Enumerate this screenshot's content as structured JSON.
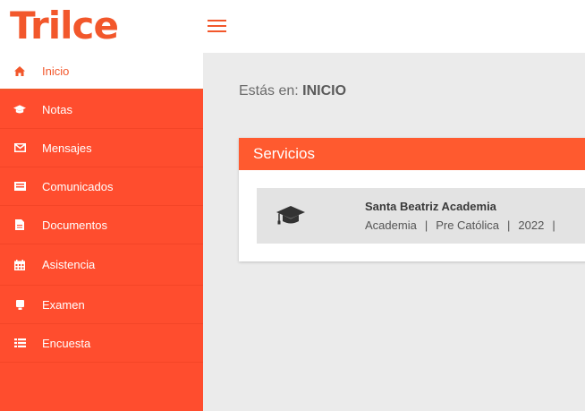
{
  "header": {
    "logo_text": "Trilce",
    "brand_color": "#f2572b"
  },
  "sidebar": {
    "items": [
      {
        "label": "Inicio",
        "icon": "home-icon",
        "active": true
      },
      {
        "label": "Notas",
        "icon": "graduation-cap-icon"
      },
      {
        "label": "Mensajes",
        "icon": "envelope-icon"
      },
      {
        "label": "Comunicados",
        "icon": "newspaper-icon"
      },
      {
        "label": "Documentos",
        "icon": "document-icon"
      },
      {
        "label": "Asistencia",
        "icon": "calendar-icon"
      },
      {
        "label": "Examen",
        "icon": "exam-icon"
      },
      {
        "label": "Encuesta",
        "icon": "list-icon"
      }
    ],
    "bg_color": "#ff4d2e"
  },
  "main": {
    "breadcrumb_prefix": "Estás en:",
    "breadcrumb_current": "INICIO",
    "panel": {
      "title": "Servicios",
      "service": {
        "icon": "graduation-cap-icon",
        "name": "Santa Beatriz Academia",
        "meta": [
          "Academia",
          "Pre Católica",
          "2022"
        ]
      }
    }
  }
}
